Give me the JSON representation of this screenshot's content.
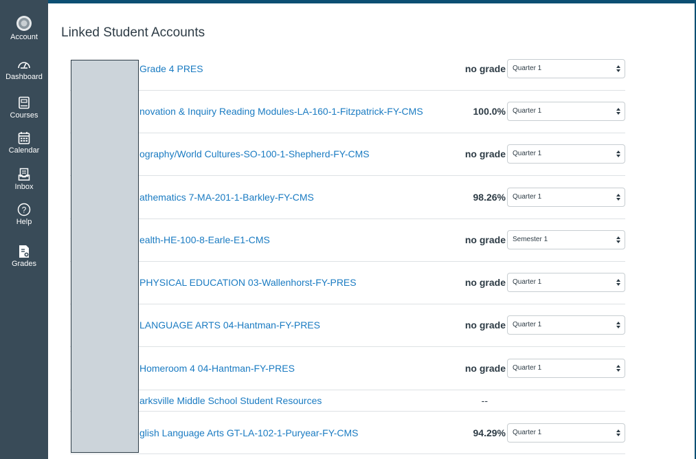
{
  "nav": {
    "account": "Account",
    "dashboard": "Dashboard",
    "courses": "Courses",
    "calendar": "Calendar",
    "inbox": "Inbox",
    "help": "Help",
    "grades": "Grades"
  },
  "page": {
    "title": "Linked Student Accounts"
  },
  "courses": [
    {
      "name": "Grade 4 PRES",
      "grade": "no grade",
      "period": "Quarter 1"
    },
    {
      "name": "novation & Inquiry Reading Modules-LA-160-1-Fitzpatrick-FY-CMS",
      "grade": "100.0%",
      "period": "Quarter 1"
    },
    {
      "name": "ography/World Cultures-SO-100-1-Shepherd-FY-CMS",
      "grade": "no grade",
      "period": "Quarter 1"
    },
    {
      "name": "athematics 7-MA-201-1-Barkley-FY-CMS",
      "grade": "98.26%",
      "period": "Quarter 1"
    },
    {
      "name": "ealth-HE-100-8-Earle-E1-CMS",
      "grade": "no grade",
      "period": "Semester 1"
    },
    {
      "name": "PHYSICAL EDUCATION 03-Wallenhorst-FY-PRES",
      "grade": "no grade",
      "period": "Quarter 1"
    },
    {
      "name": "LANGUAGE ARTS 04-Hantman-FY-PRES",
      "grade": "no grade",
      "period": "Quarter 1"
    },
    {
      "name": "Homeroom 4 04-Hantman-FY-PRES",
      "grade": "no grade",
      "period": "Quarter 1"
    },
    {
      "name": "arksville Middle School Student Resources",
      "grade": "--",
      "period": null
    },
    {
      "name": "glish Language Arts GT-LA-102-1-Puryear-FY-CMS",
      "grade": "94.29%",
      "period": "Quarter 1"
    }
  ],
  "colors": {
    "nav_background": "#394b58",
    "page_border": "#0c4f73",
    "link": "#1a7bc2",
    "text": "#2d3b45"
  }
}
